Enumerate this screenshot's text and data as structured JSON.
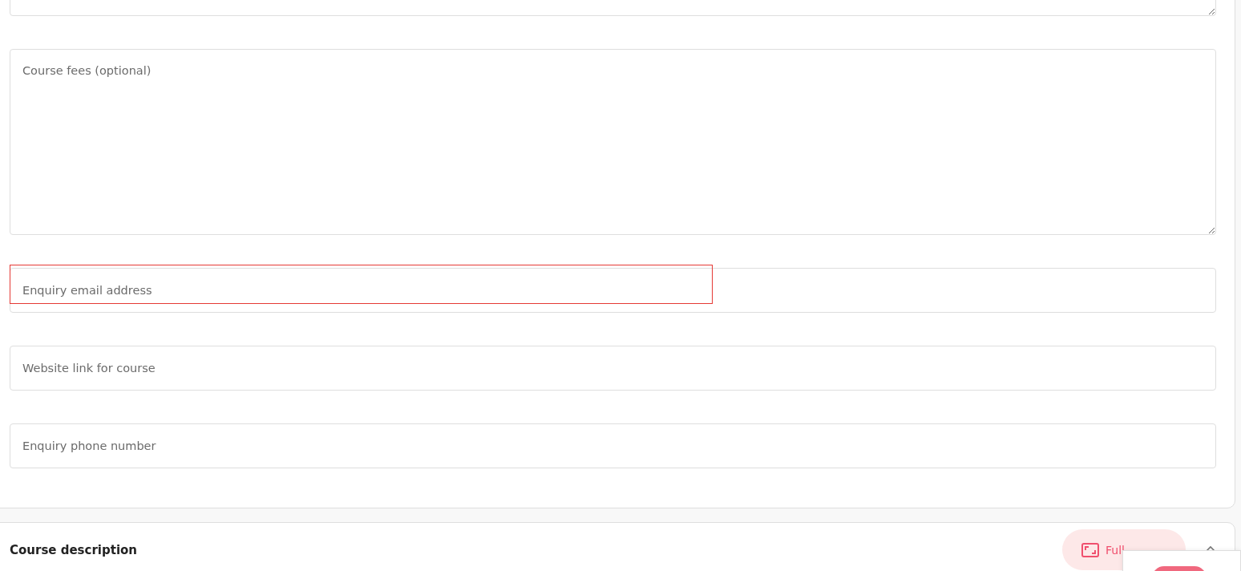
{
  "form_fields": [
    {
      "kind": "textarea",
      "highlighted": false
    },
    {
      "kind": "textarea",
      "placeholder": "Course fees (optional)",
      "highlighted": false
    },
    {
      "kind": "input",
      "placeholder": "Enquiry email address",
      "highlighted": true
    },
    {
      "kind": "input",
      "placeholder": "Website link for course",
      "highlighted": false
    },
    {
      "kind": "input",
      "placeholder": "Enquiry phone number",
      "highlighted": false
    }
  ],
  "section": {
    "title": "Course description",
    "expanded": true,
    "fullscreen_button": "Full"
  }
}
